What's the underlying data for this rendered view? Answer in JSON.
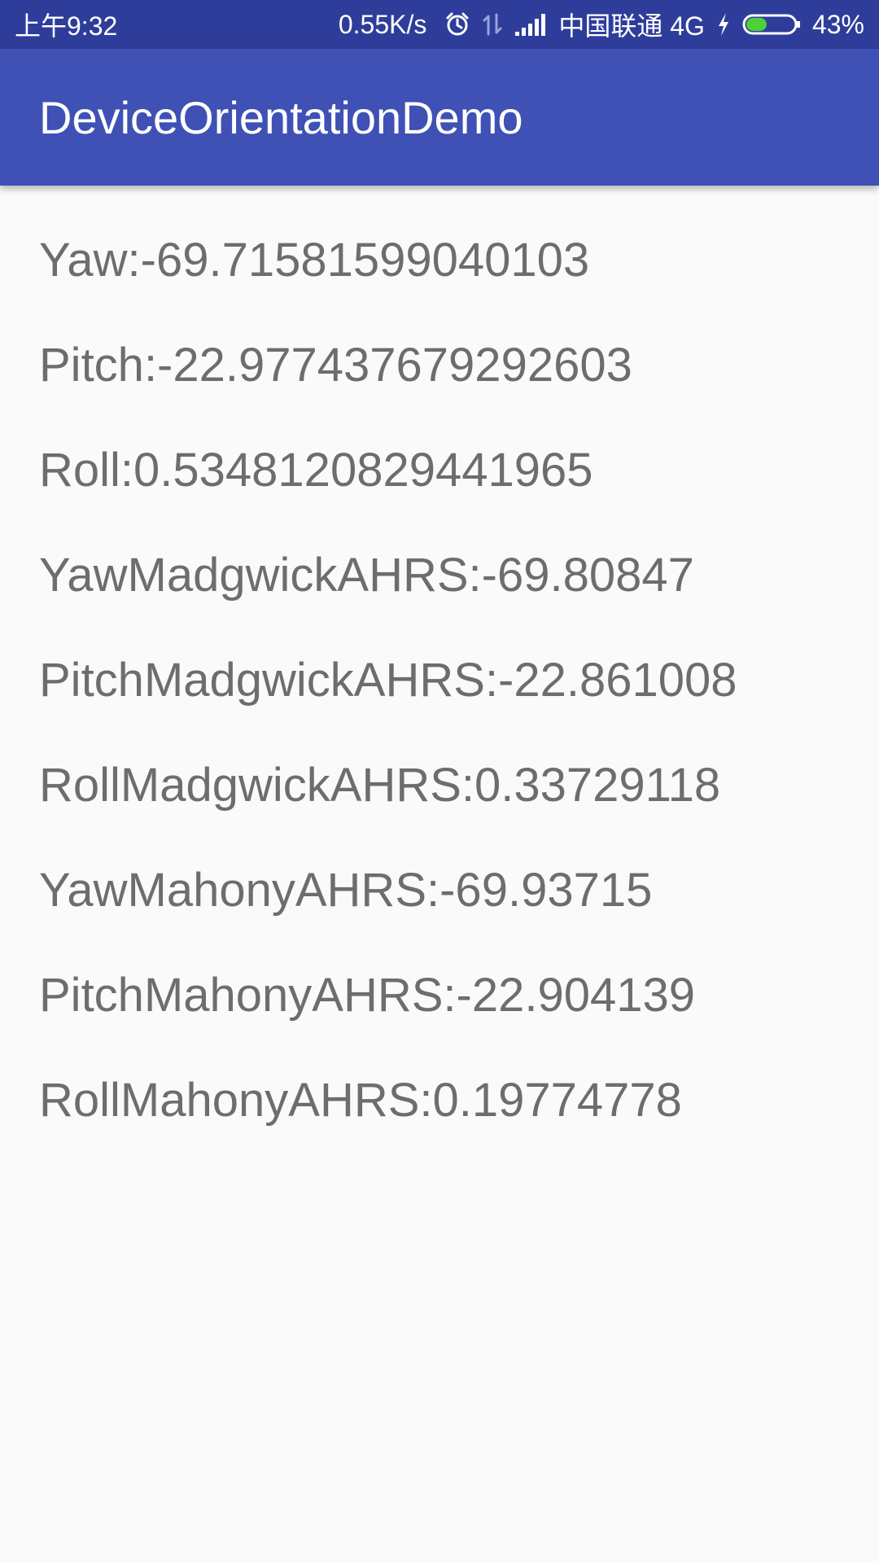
{
  "status_bar": {
    "time": "上午9:32",
    "network_speed": "0.55K/s",
    "carrier": "中国联通 4G",
    "battery_percent": "43%",
    "battery_level": 0.43,
    "icons": [
      "alarm-icon",
      "data-arrows-icon",
      "signal-icon",
      "charging-icon",
      "battery-icon"
    ]
  },
  "app_bar": {
    "title": "DeviceOrientationDemo",
    "color": "#3f51b5"
  },
  "readings": [
    "Yaw:-69.71581599040103",
    "Pitch:-22.977437679292603",
    "Roll:0.5348120829441965",
    "YawMadgwickAHRS:-69.80847",
    "PitchMadgwickAHRS:-22.861008",
    "RollMadgwickAHRS:0.33729118",
    "YawMahonyAHRS:-69.93715",
    "PitchMahonyAHRS:-22.904139",
    "RollMahonyAHRS:0.19774778"
  ]
}
